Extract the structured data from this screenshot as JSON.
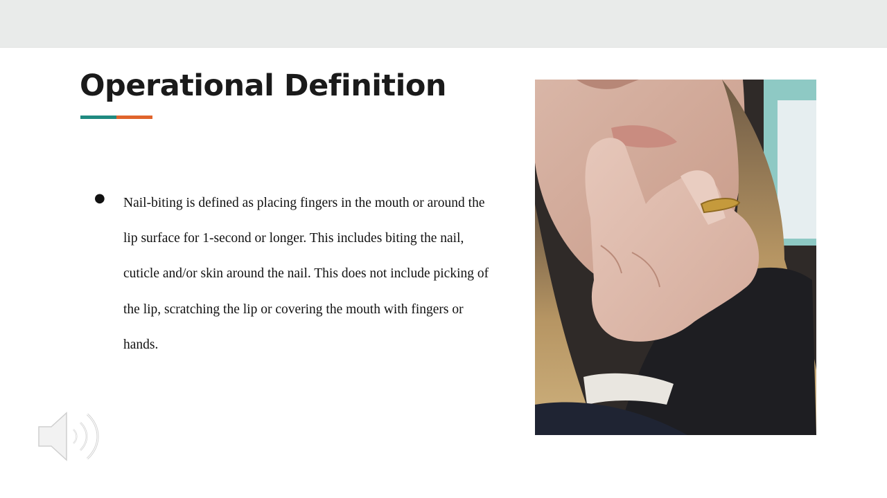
{
  "slide": {
    "title": "Operational Definition",
    "accent_colors": [
      "#1f8a80",
      "#e0642c"
    ],
    "bullets": [
      "Nail-biting is defined as placing fingers in the mouth or around the lip surface for 1-second or longer. This includes biting the nail, cuticle and/or skin around the nail. This does not include picking of the lip, scratching the lip or covering the mouth with fingers or hands."
    ],
    "bullet_glyph": "●"
  },
  "photo": {
    "icon": "photo-person-biting-nails"
  },
  "audio": {
    "icon": "speaker-icon"
  }
}
